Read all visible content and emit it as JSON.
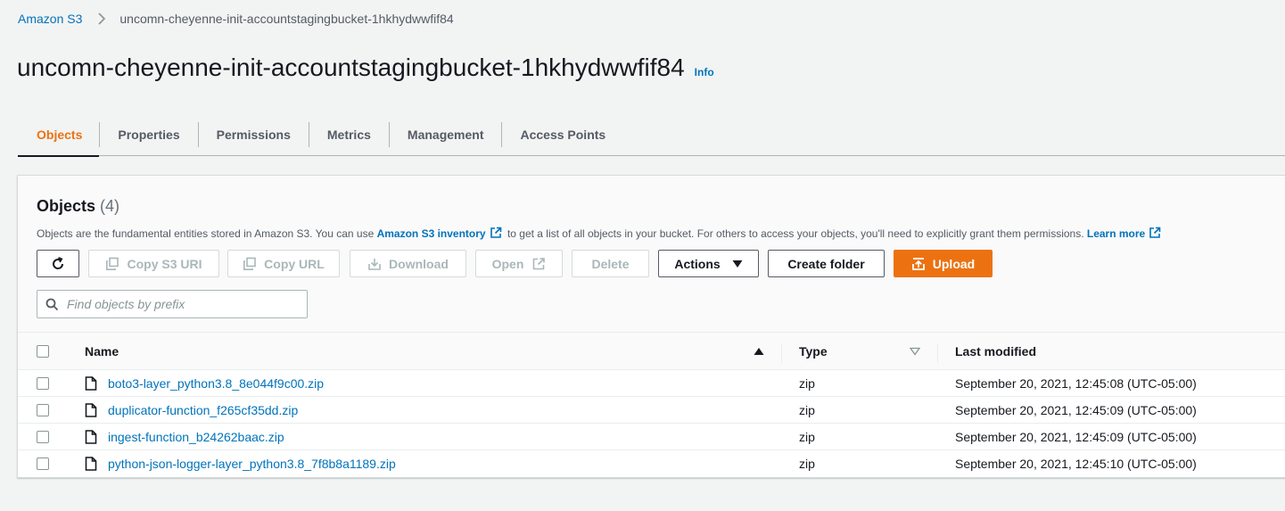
{
  "breadcrumb": {
    "root": "Amazon S3",
    "current": "uncomn-cheyenne-init-accountstagingbucket-1hkhydwwfif84"
  },
  "header": {
    "title": "uncomn-cheyenne-init-accountstagingbucket-1hkhydwwfif84",
    "info": "Info"
  },
  "tabs": [
    {
      "label": "Objects",
      "active": true
    },
    {
      "label": "Properties"
    },
    {
      "label": "Permissions"
    },
    {
      "label": "Metrics"
    },
    {
      "label": "Management"
    },
    {
      "label": "Access Points"
    }
  ],
  "objects_panel": {
    "title": "Objects",
    "count": "(4)",
    "desc_part1": "Objects are the fundamental entities stored in Amazon S3. You can use ",
    "desc_link1": "Amazon S3 inventory",
    "desc_part2": " to get a list of all objects in your bucket. For others to access your objects, you'll need to explicitly grant them permissions. ",
    "desc_link2": "Learn more"
  },
  "toolbar": {
    "refresh_icon": "refresh-icon",
    "copy_s3_uri": "Copy S3 URI",
    "copy_url": "Copy URL",
    "download": "Download",
    "open": "Open",
    "delete": "Delete",
    "actions": "Actions",
    "create_folder": "Create folder",
    "upload": "Upload"
  },
  "search": {
    "placeholder": "Find objects by prefix"
  },
  "table": {
    "columns": {
      "name": "Name",
      "type": "Type",
      "last_modified": "Last modified"
    },
    "rows": [
      {
        "name": "boto3-layer_python3.8_8e044f9c00.zip",
        "type": "zip",
        "last_modified": "September 20, 2021, 12:45:08 (UTC-05:00)"
      },
      {
        "name": "duplicator-function_f265cf35dd.zip",
        "type": "zip",
        "last_modified": "September 20, 2021, 12:45:09 (UTC-05:00)"
      },
      {
        "name": "ingest-function_b24262baac.zip",
        "type": "zip",
        "last_modified": "September 20, 2021, 12:45:09 (UTC-05:00)"
      },
      {
        "name": "python-json-logger-layer_python3.8_7f8b8a1189.zip",
        "type": "zip",
        "last_modified": "September 20, 2021, 12:45:10 (UTC-05:00)"
      }
    ]
  },
  "colors": {
    "link": "#0073bb",
    "accent": "#ec7211",
    "text": "#16191f",
    "muted": "#545b64"
  }
}
